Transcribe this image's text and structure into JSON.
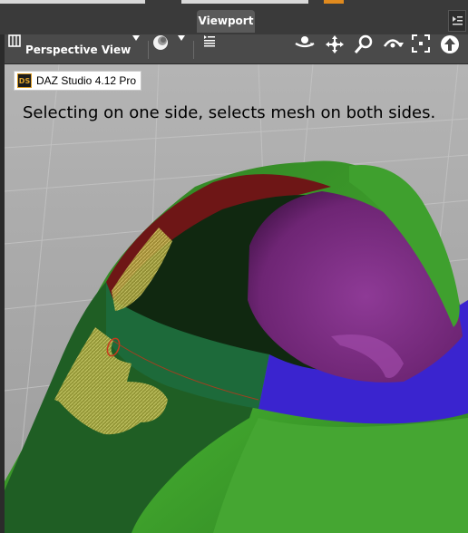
{
  "panel": {
    "tab_label": "Viewport"
  },
  "toolbar": {
    "view_label": "Perspective View",
    "icons": [
      "viewport-layout-icon",
      "view-dropdown-icon",
      "shading-sphere-icon",
      "shading-dropdown-icon",
      "list-menu-icon",
      "orbit-icon",
      "pan-icon",
      "zoom-icon",
      "rotate-icon",
      "frame-icon",
      "up-arrow-icon"
    ]
  },
  "viewport": {
    "app_badge_logo": "DS",
    "app_badge_text": "DAZ Studio 4.12 Pro",
    "caption": "Selecting on one side, selects mesh on both sides."
  },
  "colors": {
    "mesh_green": "#3a9a2a",
    "mesh_dark_green": "#1e5a22",
    "mesh_purple": "#7a2a80",
    "mesh_blue": "#3a24d0",
    "mesh_red": "#7a1a1a",
    "selection_yellow": "#c8b84a",
    "viewport_bg": "#a7a7a7"
  }
}
